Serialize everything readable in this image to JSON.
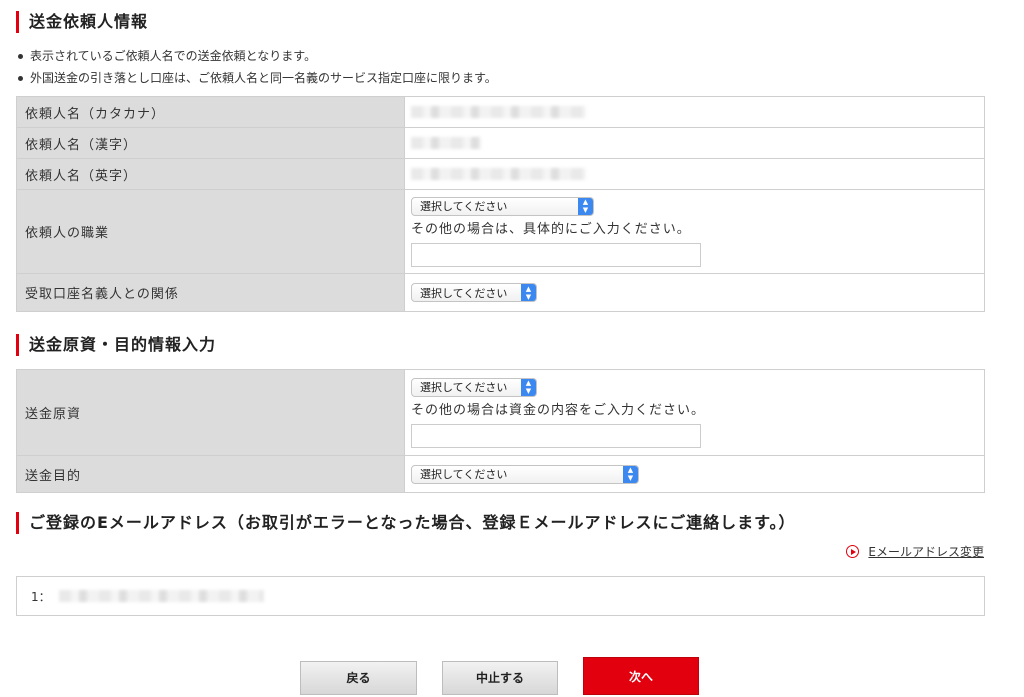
{
  "sections": {
    "remitter_info": "送金依頼人情報",
    "funds_info": "送金原資・目的情報入力",
    "email_info": "ご登録のEメールアドレス（お取引がエラーとなった場合、登録Ｅメールアドレスにご連絡します。）"
  },
  "notes": [
    "表示されているご依頼人名での送金依頼となります。",
    "外国送金の引き落とし口座は、ご依頼人名と同一名義のサービス指定口座に限ります。"
  ],
  "remitter_table": {
    "name_kana_label": "依頼人名（カタカナ）",
    "name_kanji_label": "依頼人名（漢字）",
    "name_english_label": "依頼人名（英字）",
    "occupation_label": "依頼人の職業",
    "occupation_select": "選択してください",
    "occupation_other_text": "その他の場合は、具体的にご入力ください。",
    "relationship_label": "受取口座名義人との関係",
    "relationship_select": "選択してください"
  },
  "funds_table": {
    "source_label": "送金原資",
    "source_select": "選択してください",
    "source_other_text": "その他の場合は資金の内容をご入力ください。",
    "purpose_label": "送金目的",
    "purpose_select": "選択してください"
  },
  "email": {
    "change_link": "Eメールアドレス変更",
    "entry_prefix": "1："
  },
  "buttons": {
    "back": "戻る",
    "cancel": "中止する",
    "next": "次へ"
  },
  "colors": {
    "accent": "#e2000e",
    "label_bg": "#dcdcdc",
    "select_arrow": "#3b88f1"
  }
}
